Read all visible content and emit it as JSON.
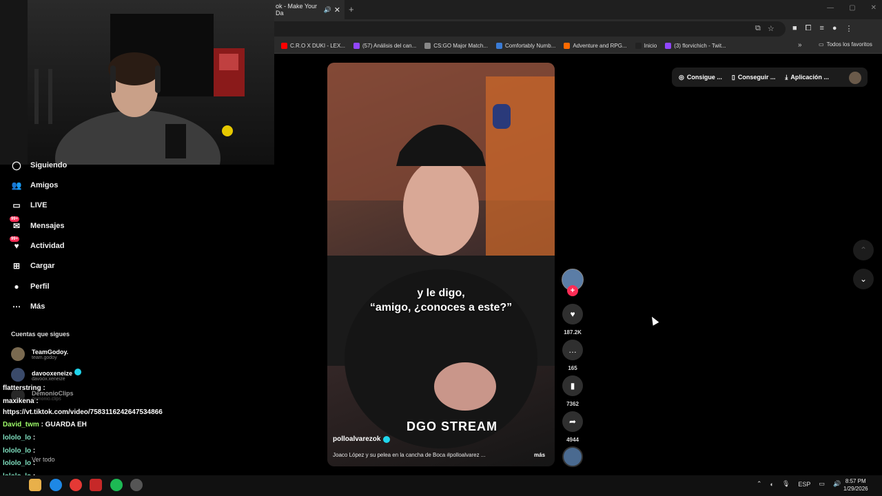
{
  "browser": {
    "tab_title": "ok - Make Your Da",
    "tab_close": "✕",
    "new_tab": "+",
    "window_controls": [
      "—",
      "▢",
      "✕"
    ],
    "bookmarks": [
      {
        "label": "C.R.O X DUKI - LEX...",
        "color": "#ff0000"
      },
      {
        "label": "(57) Análisis del can...",
        "color": "#9146ff"
      },
      {
        "label": "CS:GO Major Match...",
        "color": "#888888"
      },
      {
        "label": "Comfortably Numb...",
        "color": "#3a7bd5"
      },
      {
        "label": "Adventure and RPG...",
        "color": "#ff6a00"
      },
      {
        "label": "Inicio",
        "color": "#222222"
      },
      {
        "label": "(3) florvichich - Twit...",
        "color": "#9146ff"
      }
    ],
    "bookmarks_more": "»",
    "all_bookmarks": "Todos los favoritos"
  },
  "sidebar": {
    "items": [
      {
        "label": "Siguiendo",
        "icon": "following-icon"
      },
      {
        "label": "Amigos",
        "icon": "friends-icon"
      },
      {
        "label": "LIVE",
        "icon": "live-icon"
      },
      {
        "label": "Mensajes",
        "icon": "messages-icon",
        "badge": "99+"
      },
      {
        "label": "Actividad",
        "icon": "activity-icon",
        "badge": "99+"
      },
      {
        "label": "Cargar",
        "icon": "upload-icon"
      },
      {
        "label": "Perfil",
        "icon": "profile-icon"
      },
      {
        "label": "Más",
        "icon": "more-icon"
      }
    ],
    "following_title": "Cuentas que sigues",
    "accounts": [
      {
        "name": "TeamGodoy.",
        "handle": "team.godoy"
      },
      {
        "name": "davooxeneize",
        "handle": "davoox.xeneize"
      },
      {
        "name": "DemonioClips",
        "handle": "demonio.clips"
      }
    ],
    "see_all": "Ver todo"
  },
  "chat": [
    {
      "user": "flatterstring",
      "text": " :"
    },
    {
      "user": "maxikena",
      "text": " :"
    },
    {
      "user": "",
      "text": "https://vt.tiktok.com/video/7583116242647534866"
    },
    {
      "user": "David_twm",
      "text": " : GUARDA EH"
    },
    {
      "user": "lololo_lo",
      "text": " :"
    },
    {
      "user": "lololo_lo",
      "text": " :"
    },
    {
      "user": "lololo_lo",
      "text": " :"
    },
    {
      "user": "lololo_lo",
      "text": " :"
    },
    {
      "user": "lololo_lo",
      "text": " :"
    }
  ],
  "video": {
    "caption_line1": "y le digo,",
    "caption_line2": "“amigo, ¿conoces a este?”",
    "watermark": "DGO STREAM",
    "author": "polloalvarezok",
    "description": "Joaco López y su pelea en la cancha de Boca #polloalvarez ...",
    "more": "más"
  },
  "actions": {
    "likes": "187.2K",
    "comments": "165",
    "saves": "7362",
    "shares": "4944"
  },
  "top_buttons": [
    {
      "label": "Consigue ...",
      "icon": "coin-icon"
    },
    {
      "label": "Conseguir ...",
      "icon": "phone-icon"
    },
    {
      "label": "Aplicación ...",
      "icon": "download-icon"
    }
  ],
  "taskbar": {
    "lang": "ESP",
    "time": "8:57 PM",
    "date": "1/29/2026"
  },
  "colors": {
    "accent": "#fe2c55",
    "verified": "#20d5ec"
  }
}
